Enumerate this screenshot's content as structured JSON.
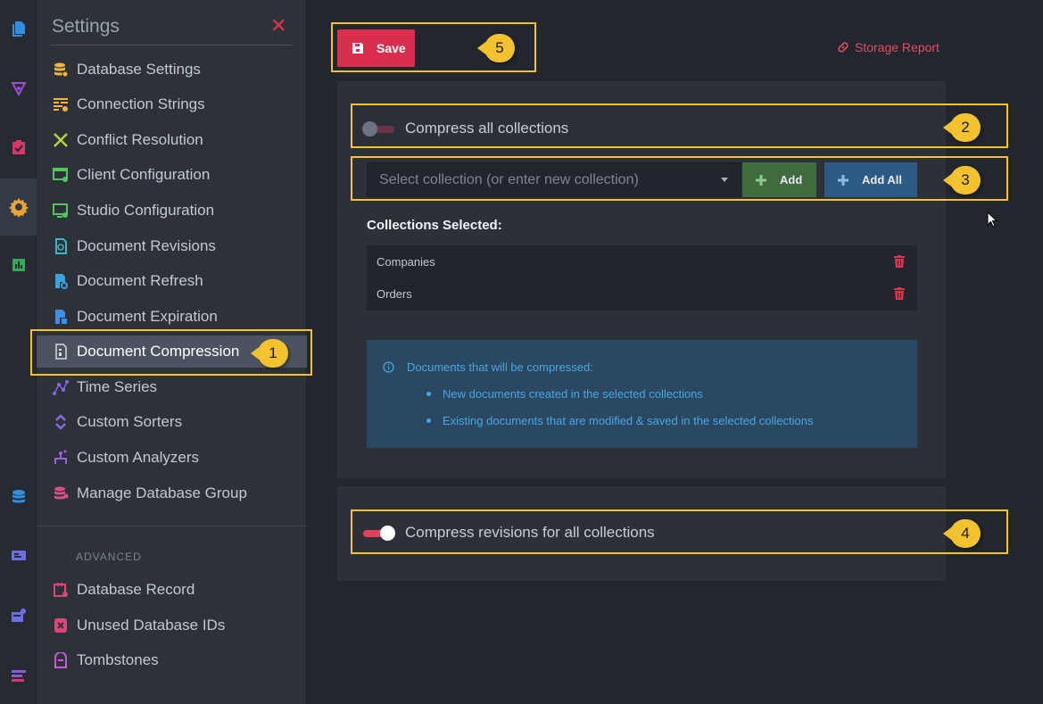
{
  "rail": {
    "icons": [
      "documents-icon",
      "query-icon",
      "tasks-icon",
      "settings-icon",
      "stats-icon",
      "databases-icon",
      "server-dashboard-icon",
      "manage-server-icon",
      "about-icon"
    ],
    "active": "settings-icon"
  },
  "panel": {
    "title": "Settings",
    "close_icon": "close-icon",
    "items": [
      {
        "label": "Database Settings",
        "icon": "database-settings-icon",
        "color": "#f0b73f"
      },
      {
        "label": "Connection Strings",
        "icon": "connection-strings-icon",
        "color": "#f0b73f"
      },
      {
        "label": "Conflict Resolution",
        "icon": "conflict-resolution-icon",
        "color": "#b7d33c"
      },
      {
        "label": "Client Configuration",
        "icon": "client-configuration-icon",
        "color": "#56c45d"
      },
      {
        "label": "Studio Configuration",
        "icon": "studio-configuration-icon",
        "color": "#56c45d"
      },
      {
        "label": "Document Revisions",
        "icon": "document-revisions-icon",
        "color": "#37b8c9"
      },
      {
        "label": "Document Refresh",
        "icon": "document-refresh-icon",
        "color": "#37a4e0"
      },
      {
        "label": "Document Expiration",
        "icon": "document-expiration-icon",
        "color": "#3c8fe6"
      },
      {
        "label": "Document Compression",
        "icon": "document-compression-icon",
        "color": "#c3c9d1"
      },
      {
        "label": "Time Series",
        "icon": "time-series-icon",
        "color": "#8a67e6"
      },
      {
        "label": "Custom Sorters",
        "icon": "custom-sorters-icon",
        "color": "#8a67e6"
      },
      {
        "label": "Custom Analyzers",
        "icon": "custom-analyzers-icon",
        "color": "#9a62e0"
      },
      {
        "label": "Manage Database Group",
        "icon": "manage-database-group-icon",
        "color": "#d94f8a"
      }
    ],
    "active_item": "Document Compression",
    "advanced_label": "ADVANCED",
    "advanced_items": [
      {
        "label": "Database Record",
        "icon": "database-record-icon",
        "color": "#e0457a"
      },
      {
        "label": "Unused Database IDs",
        "icon": "unused-database-ids-icon",
        "color": "#e0457a"
      },
      {
        "label": "Tombstones",
        "icon": "tombstones-icon",
        "color": "#c95bd2"
      }
    ]
  },
  "toolbar": {
    "save_label": "Save",
    "storage_report_label": "Storage Report"
  },
  "compression": {
    "compress_all_label": "Compress all collections",
    "compress_all_on": false,
    "select_placeholder": "Select collection (or enter new collection)",
    "add_label": "Add",
    "add_all_label": "Add All",
    "selected_heading": "Collections Selected:",
    "selected": [
      "Companies",
      "Orders"
    ],
    "info_title": "Documents that will be compressed:",
    "info_items": [
      "New documents created in the selected collections",
      "Existing documents that are modified & saved in the selected collections"
    ],
    "revisions_label": "Compress revisions for all collections",
    "revisions_on": true
  },
  "annotations": [
    "1",
    "2",
    "3",
    "4",
    "5"
  ],
  "colors": {
    "accent": "#db2d4e",
    "highlight": "#f4c22e",
    "add": "#3f6b3f",
    "add_all": "#2d5b86",
    "info": "#48a7e3"
  }
}
